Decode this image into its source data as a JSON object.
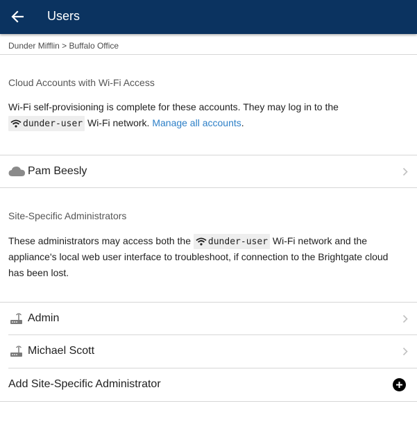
{
  "header": {
    "title": "Users",
    "back_icon": "arrow-left-icon",
    "background": "#0b3360"
  },
  "breadcrumb": "Dunder Mifflin > Buffalo Office",
  "cloud_section": {
    "title": "Cloud Accounts with Wi-Fi Access",
    "para_before_chip": "Wi-Fi self-provisioning is complete for these accounts. They may log in to the",
    "network_name": "dunder-user",
    "para_after_chip": " Wi-Fi network. ",
    "manage_link": "Manage all accounts",
    "para_end": ".",
    "accounts": [
      {
        "name": "Pam Beesly",
        "icon": "cloud-icon"
      }
    ]
  },
  "admin_section": {
    "title": "Site-Specific Administrators",
    "para_before_chip": "These administrators may access both the ",
    "network_name": "dunder-user",
    "para_after_chip": " Wi-Fi network and the appliance's local web user interface to troubleshoot, if connection to the Brightgate cloud has been lost.",
    "admins": [
      {
        "name": "Admin",
        "icon": "router-icon"
      },
      {
        "name": "Michael Scott",
        "icon": "router-icon"
      }
    ],
    "add_label": "Add Site-Specific Administrator"
  },
  "colors": {
    "link": "#2c7fc7",
    "divider": "#d6d6d6",
    "chip_background": "#eeeeee"
  }
}
